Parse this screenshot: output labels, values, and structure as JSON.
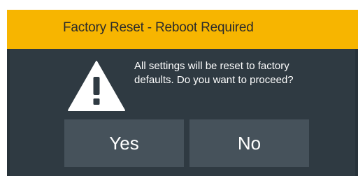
{
  "dialog": {
    "title": "Factory Reset - Reboot Required",
    "message": "All settings will be reset to factory defaults. Do you want to proceed?",
    "icon": "warning-icon",
    "buttons": {
      "yes": "Yes",
      "no": "No"
    }
  },
  "colors": {
    "title_bar": "#f7b500",
    "dialog_bg": "#2f3a42",
    "button_bg": "#46525b"
  }
}
